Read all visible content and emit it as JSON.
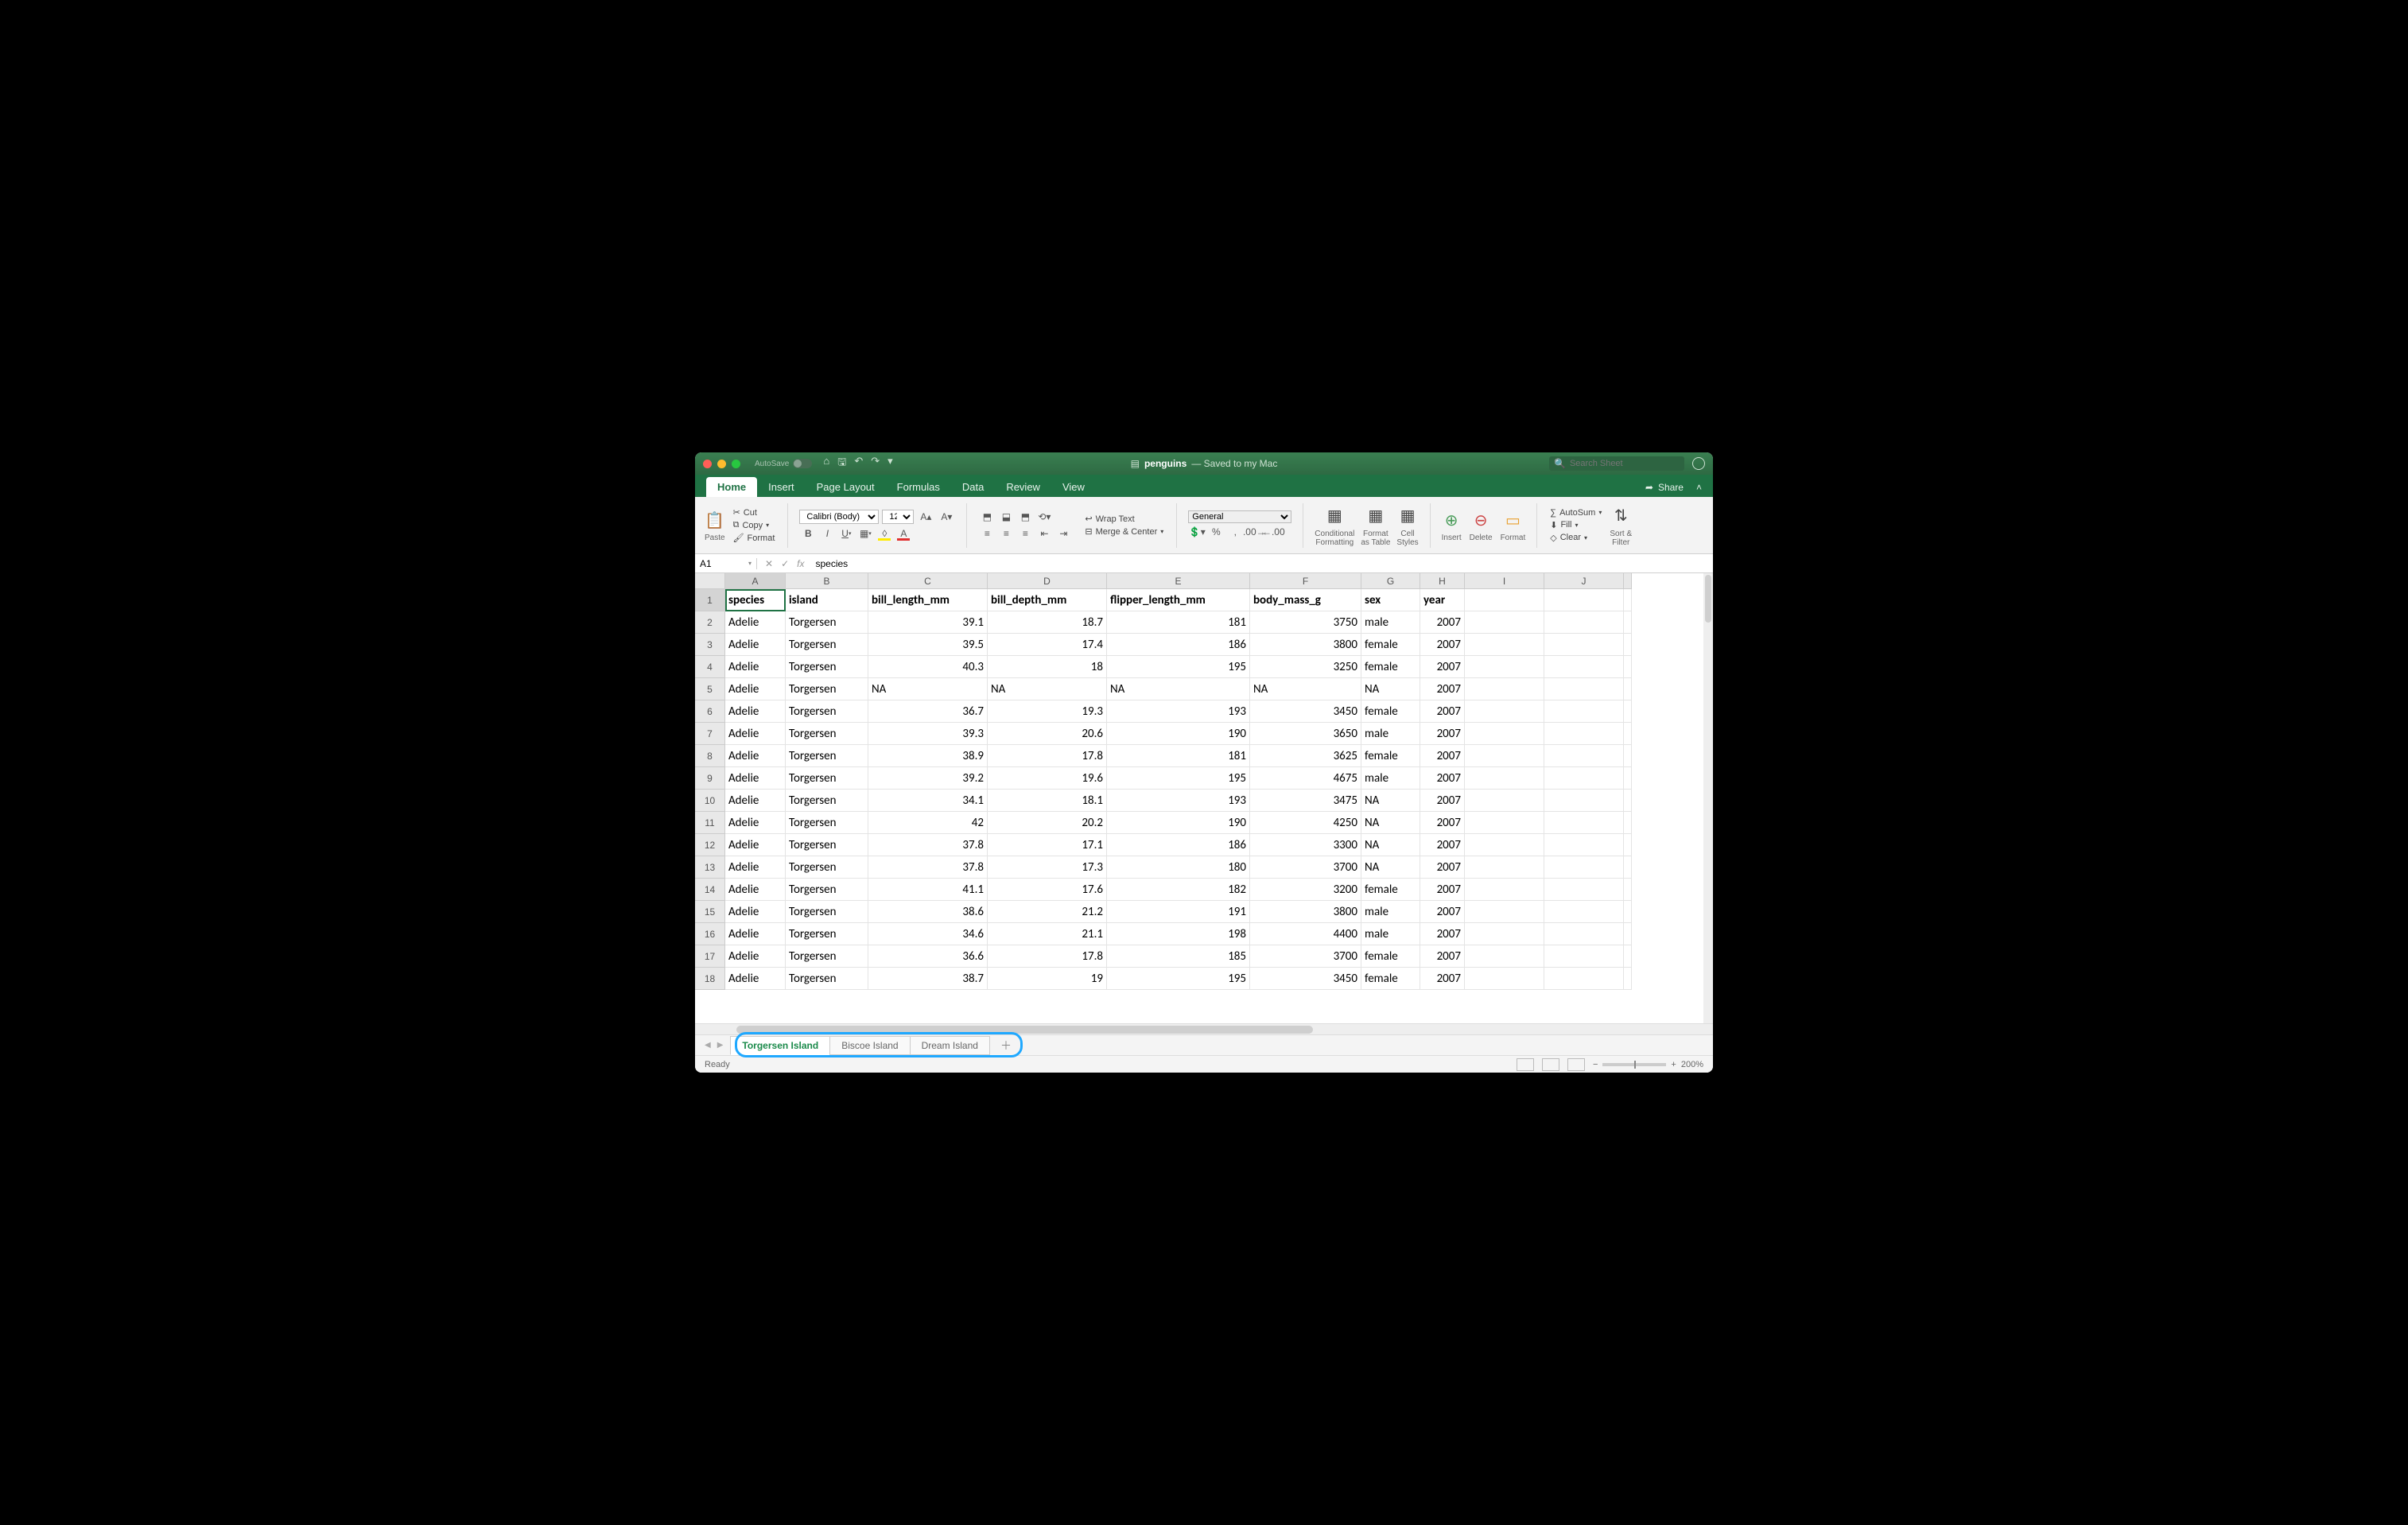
{
  "title": {
    "filename": "penguins",
    "status": "— Saved to my Mac"
  },
  "autosave_label": "AutoSave",
  "search_placeholder": "Search Sheet",
  "ribbon_tabs": [
    "Home",
    "Insert",
    "Page Layout",
    "Formulas",
    "Data",
    "Review",
    "View"
  ],
  "active_ribbon_tab": "Home",
  "share_label": "Share",
  "clipboard": {
    "paste": "Paste",
    "cut": "Cut",
    "copy": "Copy",
    "format": "Format"
  },
  "font": {
    "name": "Calibri (Body)",
    "size": "12"
  },
  "alignment": {
    "wrap": "Wrap Text",
    "merge": "Merge & Center"
  },
  "number_format": "General",
  "styles": {
    "cond": "Conditional\nFormatting",
    "table": "Format\nas Table",
    "cell": "Cell\nStyles"
  },
  "cells": {
    "insert": "Insert",
    "delete": "Delete",
    "format": "Format"
  },
  "editing": {
    "sum": "AutoSum",
    "fill": "Fill",
    "clear": "Clear",
    "sort": "Sort &\nFilter"
  },
  "namebox": "A1",
  "formula": "species",
  "columns": [
    "A",
    "B",
    "C",
    "D",
    "E",
    "F",
    "G",
    "H",
    "I",
    "J"
  ],
  "headers": [
    "species",
    "island",
    "bill_length_mm",
    "bill_depth_mm",
    "flipper_length_mm",
    "body_mass_g",
    "sex",
    "year"
  ],
  "rows": [
    [
      "Adelie",
      "Torgersen",
      "39.1",
      "18.7",
      "181",
      "3750",
      "male",
      "2007"
    ],
    [
      "Adelie",
      "Torgersen",
      "39.5",
      "17.4",
      "186",
      "3800",
      "female",
      "2007"
    ],
    [
      "Adelie",
      "Torgersen",
      "40.3",
      "18",
      "195",
      "3250",
      "female",
      "2007"
    ],
    [
      "Adelie",
      "Torgersen",
      "NA",
      "NA",
      "NA",
      "NA",
      "NA",
      "2007"
    ],
    [
      "Adelie",
      "Torgersen",
      "36.7",
      "19.3",
      "193",
      "3450",
      "female",
      "2007"
    ],
    [
      "Adelie",
      "Torgersen",
      "39.3",
      "20.6",
      "190",
      "3650",
      "male",
      "2007"
    ],
    [
      "Adelie",
      "Torgersen",
      "38.9",
      "17.8",
      "181",
      "3625",
      "female",
      "2007"
    ],
    [
      "Adelie",
      "Torgersen",
      "39.2",
      "19.6",
      "195",
      "4675",
      "male",
      "2007"
    ],
    [
      "Adelie",
      "Torgersen",
      "34.1",
      "18.1",
      "193",
      "3475",
      "NA",
      "2007"
    ],
    [
      "Adelie",
      "Torgersen",
      "42",
      "20.2",
      "190",
      "4250",
      "NA",
      "2007"
    ],
    [
      "Adelie",
      "Torgersen",
      "37.8",
      "17.1",
      "186",
      "3300",
      "NA",
      "2007"
    ],
    [
      "Adelie",
      "Torgersen",
      "37.8",
      "17.3",
      "180",
      "3700",
      "NA",
      "2007"
    ],
    [
      "Adelie",
      "Torgersen",
      "41.1",
      "17.6",
      "182",
      "3200",
      "female",
      "2007"
    ],
    [
      "Adelie",
      "Torgersen",
      "38.6",
      "21.2",
      "191",
      "3800",
      "male",
      "2007"
    ],
    [
      "Adelie",
      "Torgersen",
      "34.6",
      "21.1",
      "198",
      "4400",
      "male",
      "2007"
    ],
    [
      "Adelie",
      "Torgersen",
      "36.6",
      "17.8",
      "185",
      "3700",
      "female",
      "2007"
    ],
    [
      "Adelie",
      "Torgersen",
      "38.7",
      "19",
      "195",
      "3450",
      "female",
      "2007"
    ]
  ],
  "numeric_cols": [
    2,
    3,
    4,
    5,
    7
  ],
  "na_text_cols": [
    0,
    1,
    6
  ],
  "sheet_tabs": [
    "Torgersen Island",
    "Biscoe Island",
    "Dream Island"
  ],
  "active_sheet": 0,
  "status_text": "Ready",
  "zoom": "200%"
}
